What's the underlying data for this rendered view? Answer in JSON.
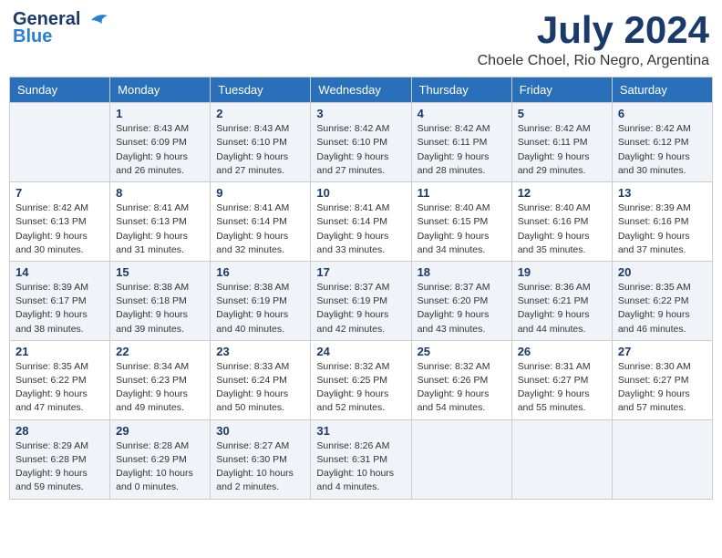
{
  "header": {
    "logo_line1": "General",
    "logo_line2": "Blue",
    "month": "July 2024",
    "location": "Choele Choel, Rio Negro, Argentina"
  },
  "weekdays": [
    "Sunday",
    "Monday",
    "Tuesday",
    "Wednesday",
    "Thursday",
    "Friday",
    "Saturday"
  ],
  "weeks": [
    [
      {
        "day": "",
        "detail": ""
      },
      {
        "day": "1",
        "detail": "Sunrise: 8:43 AM\nSunset: 6:09 PM\nDaylight: 9 hours\nand 26 minutes."
      },
      {
        "day": "2",
        "detail": "Sunrise: 8:43 AM\nSunset: 6:10 PM\nDaylight: 9 hours\nand 27 minutes."
      },
      {
        "day": "3",
        "detail": "Sunrise: 8:42 AM\nSunset: 6:10 PM\nDaylight: 9 hours\nand 27 minutes."
      },
      {
        "day": "4",
        "detail": "Sunrise: 8:42 AM\nSunset: 6:11 PM\nDaylight: 9 hours\nand 28 minutes."
      },
      {
        "day": "5",
        "detail": "Sunrise: 8:42 AM\nSunset: 6:11 PM\nDaylight: 9 hours\nand 29 minutes."
      },
      {
        "day": "6",
        "detail": "Sunrise: 8:42 AM\nSunset: 6:12 PM\nDaylight: 9 hours\nand 30 minutes."
      }
    ],
    [
      {
        "day": "7",
        "detail": ""
      },
      {
        "day": "8",
        "detail": "Sunrise: 8:41 AM\nSunset: 6:13 PM\nDaylight: 9 hours\nand 31 minutes."
      },
      {
        "day": "9",
        "detail": "Sunrise: 8:41 AM\nSunset: 6:14 PM\nDaylight: 9 hours\nand 32 minutes."
      },
      {
        "day": "10",
        "detail": "Sunrise: 8:41 AM\nSunset: 6:14 PM\nDaylight: 9 hours\nand 33 minutes."
      },
      {
        "day": "11",
        "detail": "Sunrise: 8:40 AM\nSunset: 6:15 PM\nDaylight: 9 hours\nand 34 minutes."
      },
      {
        "day": "12",
        "detail": "Sunrise: 8:40 AM\nSunset: 6:16 PM\nDaylight: 9 hours\nand 35 minutes."
      },
      {
        "day": "13",
        "detail": "Sunrise: 8:39 AM\nSunset: 6:16 PM\nDaylight: 9 hours\nand 37 minutes."
      }
    ],
    [
      {
        "day": "14",
        "detail": ""
      },
      {
        "day": "15",
        "detail": "Sunrise: 8:38 AM\nSunset: 6:18 PM\nDaylight: 9 hours\nand 39 minutes."
      },
      {
        "day": "16",
        "detail": "Sunrise: 8:38 AM\nSunset: 6:19 PM\nDaylight: 9 hours\nand 40 minutes."
      },
      {
        "day": "17",
        "detail": "Sunrise: 8:37 AM\nSunset: 6:19 PM\nDaylight: 9 hours\nand 42 minutes."
      },
      {
        "day": "18",
        "detail": "Sunrise: 8:37 AM\nSunset: 6:20 PM\nDaylight: 9 hours\nand 43 minutes."
      },
      {
        "day": "19",
        "detail": "Sunrise: 8:36 AM\nSunset: 6:21 PM\nDaylight: 9 hours\nand 44 minutes."
      },
      {
        "day": "20",
        "detail": "Sunrise: 8:35 AM\nSunset: 6:22 PM\nDaylight: 9 hours\nand 46 minutes."
      }
    ],
    [
      {
        "day": "21",
        "detail": ""
      },
      {
        "day": "22",
        "detail": "Sunrise: 8:34 AM\nSunset: 6:23 PM\nDaylight: 9 hours\nand 49 minutes."
      },
      {
        "day": "23",
        "detail": "Sunrise: 8:33 AM\nSunset: 6:24 PM\nDaylight: 9 hours\nand 50 minutes."
      },
      {
        "day": "24",
        "detail": "Sunrise: 8:32 AM\nSunset: 6:25 PM\nDaylight: 9 hours\nand 52 minutes."
      },
      {
        "day": "25",
        "detail": "Sunrise: 8:32 AM\nSunset: 6:26 PM\nDaylight: 9 hours\nand 54 minutes."
      },
      {
        "day": "26",
        "detail": "Sunrise: 8:31 AM\nSunset: 6:27 PM\nDaylight: 9 hours\nand 55 minutes."
      },
      {
        "day": "27",
        "detail": "Sunrise: 8:30 AM\nSunset: 6:27 PM\nDaylight: 9 hours\nand 57 minutes."
      }
    ],
    [
      {
        "day": "28",
        "detail": "Sunrise: 8:29 AM\nSunset: 6:28 PM\nDaylight: 9 hours\nand 59 minutes."
      },
      {
        "day": "29",
        "detail": "Sunrise: 8:28 AM\nSunset: 6:29 PM\nDaylight: 10 hours\nand 0 minutes."
      },
      {
        "day": "30",
        "detail": "Sunrise: 8:27 AM\nSunset: 6:30 PM\nDaylight: 10 hours\nand 2 minutes."
      },
      {
        "day": "31",
        "detail": "Sunrise: 8:26 AM\nSunset: 6:31 PM\nDaylight: 10 hours\nand 4 minutes."
      },
      {
        "day": "",
        "detail": ""
      },
      {
        "day": "",
        "detail": ""
      },
      {
        "day": "",
        "detail": ""
      }
    ]
  ],
  "week7_sun_detail": "Sunrise: 8:42 AM\nSunset: 6:13 PM\nDaylight: 9 hours\nand 30 minutes.",
  "week14_sun_detail": "Sunrise: 8:39 AM\nSunset: 6:17 PM\nDaylight: 9 hours\nand 38 minutes.",
  "week21_sun_detail": "Sunrise: 8:35 AM\nSunset: 6:22 PM\nDaylight: 9 hours\nand 47 minutes."
}
